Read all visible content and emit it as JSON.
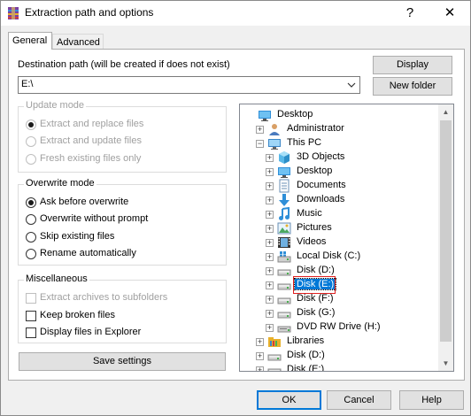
{
  "window": {
    "title": "Extraction path and options",
    "help_glyph": "?",
    "close_glyph": "✕"
  },
  "tabs": [
    {
      "label": "General",
      "selected": true
    },
    {
      "label": "Advanced",
      "selected": false
    }
  ],
  "destination": {
    "label": "Destination path (will be created if does not exist)",
    "value": "E:\\",
    "display_button": "Display",
    "new_folder_button": "New folder"
  },
  "update_mode": {
    "title": "Update mode",
    "options": [
      {
        "label": "Extract and replace files",
        "selected": true,
        "enabled": false
      },
      {
        "label": "Extract and update files",
        "selected": false,
        "enabled": false
      },
      {
        "label": "Fresh existing files only",
        "selected": false,
        "enabled": false
      }
    ]
  },
  "overwrite_mode": {
    "title": "Overwrite mode",
    "options": [
      {
        "label": "Ask before overwrite",
        "selected": true,
        "enabled": true
      },
      {
        "label": "Overwrite without prompt",
        "selected": false,
        "enabled": true
      },
      {
        "label": "Skip existing files",
        "selected": false,
        "enabled": true
      },
      {
        "label": "Rename automatically",
        "selected": false,
        "enabled": true
      }
    ]
  },
  "miscellaneous": {
    "title": "Miscellaneous",
    "options": [
      {
        "label": "Extract archives to subfolders",
        "checked": false,
        "enabled": false
      },
      {
        "label": "Keep broken files",
        "checked": false,
        "enabled": true
      },
      {
        "label": "Display files in Explorer",
        "checked": false,
        "enabled": true
      }
    ]
  },
  "save_settings_button": "Save settings",
  "tree": {
    "nodes": [
      {
        "label": "Desktop",
        "icon": "desktop-icon",
        "level": 0,
        "expander": ""
      },
      {
        "label": "Administrator",
        "icon": "user-icon",
        "level": 1,
        "expander": "+"
      },
      {
        "label": "This PC",
        "icon": "computer-icon",
        "level": 1,
        "expander": "−"
      },
      {
        "label": "3D Objects",
        "icon": "3d-objects-icon",
        "level": 2,
        "expander": "+"
      },
      {
        "label": "Desktop",
        "icon": "desktop-icon",
        "level": 2,
        "expander": "+"
      },
      {
        "label": "Documents",
        "icon": "documents-icon",
        "level": 2,
        "expander": "+"
      },
      {
        "label": "Downloads",
        "icon": "downloads-icon",
        "level": 2,
        "expander": "+"
      },
      {
        "label": "Music",
        "icon": "music-icon",
        "level": 2,
        "expander": "+"
      },
      {
        "label": "Pictures",
        "icon": "pictures-icon",
        "level": 2,
        "expander": "+"
      },
      {
        "label": "Videos",
        "icon": "videos-icon",
        "level": 2,
        "expander": "+"
      },
      {
        "label": "Local Disk (C:)",
        "icon": "windows-drive-icon",
        "level": 2,
        "expander": "+"
      },
      {
        "label": "Disk (D:)",
        "icon": "drive-icon",
        "level": 2,
        "expander": "+"
      },
      {
        "label": "Disk (E:)",
        "icon": "drive-icon",
        "level": 2,
        "expander": "+",
        "selected": true
      },
      {
        "label": "Disk (F:)",
        "icon": "drive-icon",
        "level": 2,
        "expander": "+"
      },
      {
        "label": "Disk (G:)",
        "icon": "drive-icon",
        "level": 2,
        "expander": "+"
      },
      {
        "label": "DVD RW Drive (H:)",
        "icon": "dvd-drive-icon",
        "level": 2,
        "expander": "+"
      },
      {
        "label": "Libraries",
        "icon": "libraries-icon",
        "level": 1,
        "expander": "+"
      },
      {
        "label": "Disk (D:)",
        "icon": "drive-icon",
        "level": 1,
        "expander": "+"
      },
      {
        "label": "Disk (E:)",
        "icon": "drive-icon",
        "level": 1,
        "expander": "+"
      }
    ]
  },
  "footer": {
    "ok_button": "OK",
    "cancel_button": "Cancel",
    "help_button": "Help"
  },
  "colors": {
    "selection": "#0078d7",
    "highlight_frame": "#e02020",
    "dialog_bg": "#f0f0f0"
  }
}
